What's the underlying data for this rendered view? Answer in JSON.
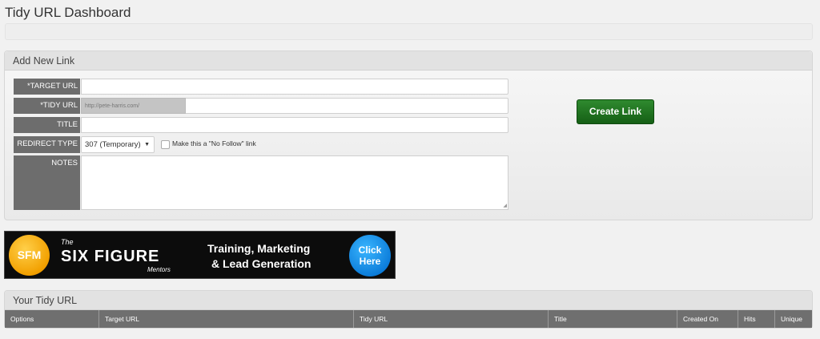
{
  "page": {
    "title": "Tidy URL Dashboard"
  },
  "add_panel": {
    "title": "Add New Link",
    "fields": {
      "target_url": {
        "label": "*TARGET URL",
        "value": ""
      },
      "tidy_url": {
        "label": "*TIDY URL",
        "prefix": "http://pete-harris.com/",
        "value": ""
      },
      "title": {
        "label": "TITLE",
        "value": ""
      },
      "redirect_type": {
        "label": "REDIRECT TYPE",
        "selected": "307 (Temporary)"
      },
      "no_follow": {
        "label": "Make this a \"No Follow\" link",
        "checked": false
      },
      "notes": {
        "label": "NOTES",
        "value": ""
      }
    },
    "create_button": "Create Link"
  },
  "banner": {
    "logo_text": "SFM",
    "the": "The",
    "brand": "SIX FIGURE",
    "mentors": "Mentors",
    "line1": "Training, Marketing",
    "line2": "& Lead Generation",
    "cta_line1": "Click",
    "cta_line2": "Here"
  },
  "tidy_panel": {
    "title": "Your Tidy URL",
    "columns": [
      "Options",
      "Target URL",
      "Tidy URL",
      "Title",
      "Created On",
      "Hits",
      "Unique"
    ]
  },
  "colors": {
    "create_button": "#1e6e1e",
    "label_bg": "#6d6d6d",
    "table_header": "#6f6f6f"
  }
}
